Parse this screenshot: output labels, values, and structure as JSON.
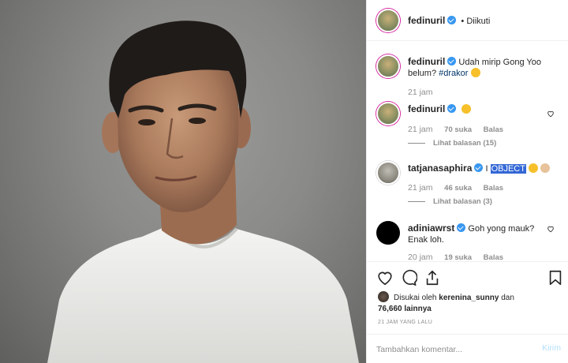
{
  "post": {
    "author": "fedinuril",
    "follow_status": "Diikuti",
    "separator": "•"
  },
  "caption": {
    "username": "fedinuril",
    "text_before": "Udah mirip Gong Yoo belum? ",
    "hashtag": "#drakor",
    "time": "21 jam"
  },
  "comments": [
    {
      "username": "fedinuril",
      "time": "21 jam",
      "likes": "70 suka",
      "reply_label": "Balas",
      "view_replies": "Lihat balasan (15)"
    },
    {
      "username": "tatjanasaphira",
      "text_prefix": "I ",
      "text_highlight": "OBJECT",
      "time": "21 jam",
      "likes": "46 suka",
      "reply_label": "Balas",
      "view_replies": "Lihat balasan (3)"
    },
    {
      "username": "adiniawrst",
      "text": "Goh yong mauk? Enak loh.",
      "time": "20 jam",
      "likes": "19 suka",
      "reply_label": "Balas"
    }
  ],
  "actions": {
    "liked_by_prefix": "Disukai oleh ",
    "liked_by_user": "kerenina_sunny",
    "liked_by_and": " dan",
    "likes_count": "76,660 lainnya",
    "timestamp": "21 JAM YANG LALU"
  },
  "comment_box": {
    "placeholder": "Tambahkan komentar...",
    "post_label": "Kirim"
  },
  "colors": {
    "verified": "#3897f0",
    "hashtag": "#003569",
    "post_button_disabled": "#b2dffc",
    "highlight": "#3367d6"
  }
}
